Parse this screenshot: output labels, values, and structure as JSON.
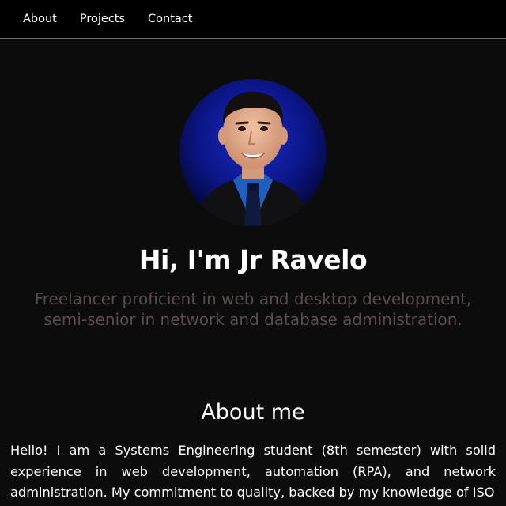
{
  "nav": {
    "items": [
      {
        "label": "About"
      },
      {
        "label": "Projects"
      },
      {
        "label": "Contact"
      }
    ]
  },
  "hero": {
    "avatar_name": "profile-photo",
    "title": "Hi, I'm Jr Ravelo",
    "subtitle": "Freelancer proficient in web and desktop development, semi-senior in network and database administration."
  },
  "about": {
    "title": "About me",
    "text": "Hello! I am a Systems Engineering student (8th semester) with solid experience in web development, automation (RPA), and network administration. My commitment to quality, backed by my knowledge of ISO"
  },
  "colors": {
    "background": "#0d0c0c",
    "navbar": "#000000",
    "subtitle": "#5a4c4c",
    "avatar_bg": "#0b1a8c"
  }
}
